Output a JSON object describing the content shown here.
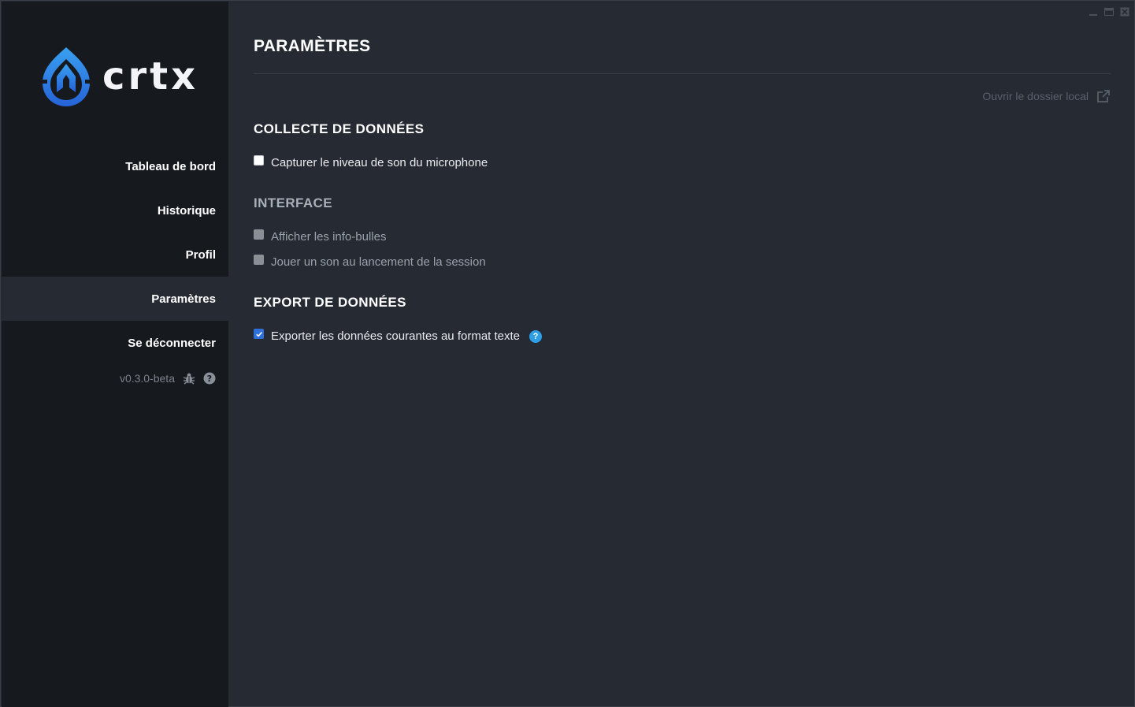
{
  "brand": {
    "name": "crtx"
  },
  "sidebar": {
    "items": [
      {
        "label": "Tableau de bord",
        "active": false
      },
      {
        "label": "Historique",
        "active": false
      },
      {
        "label": "Profil",
        "active": false
      },
      {
        "label": "Paramètres",
        "active": true
      },
      {
        "label": "Se déconnecter",
        "active": false
      }
    ],
    "version": "v0.3.0-beta",
    "icons": [
      "bug-icon",
      "help-circle-icon"
    ]
  },
  "window_controls": [
    "minimize-icon",
    "maximize-icon",
    "close-icon"
  ],
  "main": {
    "title": "PARAMÈTRES",
    "open_folder_label": "Ouvrir le dossier local",
    "sections": [
      {
        "title": "COLLECTE DE DONNÉES",
        "options": [
          {
            "label": "Capturer le niveau de son du microphone",
            "checked": false,
            "enabled": true
          }
        ]
      },
      {
        "title": "INTERFACE",
        "options": [
          {
            "label": "Afficher les info-bulles",
            "checked": false,
            "enabled": false
          },
          {
            "label": "Jouer un son au lancement de la session",
            "checked": false,
            "enabled": false
          }
        ]
      },
      {
        "title": "EXPORT DE DONNÉES",
        "options": [
          {
            "label": "Exporter les données courantes au format texte",
            "checked": true,
            "enabled": true,
            "help": "?"
          }
        ]
      }
    ]
  },
  "colors": {
    "sidebar_bg": "#161a1f",
    "main_bg": "#252a33",
    "active_nav_bg": "#262b33",
    "accent_blue": "#2f6fdc",
    "help_blue": "#2e9fe6"
  }
}
